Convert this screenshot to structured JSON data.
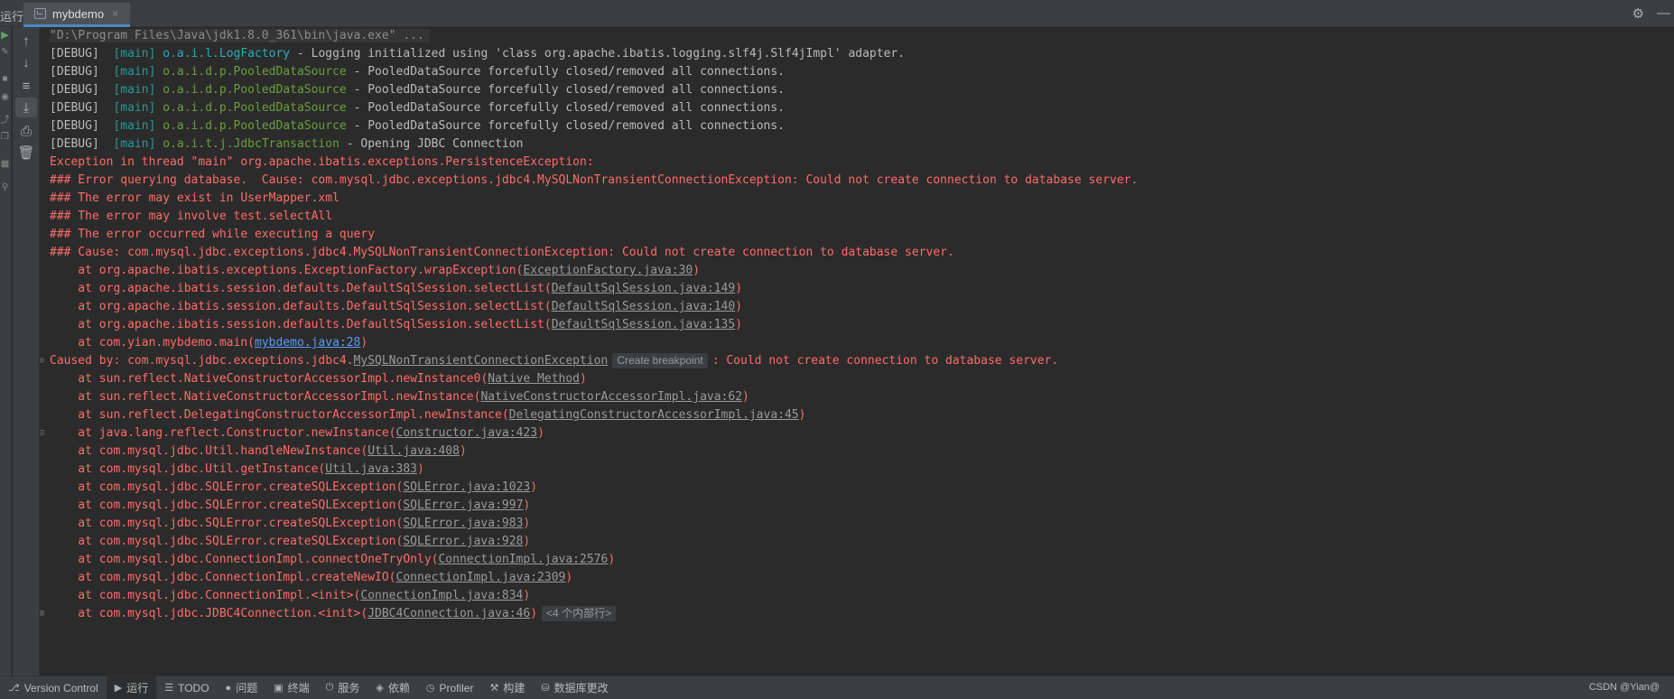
{
  "topbar": {
    "run_label": "运行:",
    "tab_title": "mybdemo",
    "tab_close": "×",
    "settings_glyph": "⚙",
    "minimize_glyph": "—"
  },
  "console": {
    "command": "\"D:\\Program Files\\Java\\jdk1.8.0_361\\bin\\java.exe\" ...",
    "debug_lines": [
      {
        "level": "[DEBUG]",
        "thread": "[main]",
        "logger": "o.a.i.l.LogFactory",
        "message": " - Logging initialized using 'class org.apache.ibatis.logging.slf4j.Slf4jImpl' adapter."
      },
      {
        "level": "[DEBUG]",
        "thread": "[main]",
        "logger": "o.a.i.d.p.PooledDataSource",
        "message": " - PooledDataSource forcefully closed/removed all connections."
      },
      {
        "level": "[DEBUG]",
        "thread": "[main]",
        "logger": "o.a.i.d.p.PooledDataSource",
        "message": " - PooledDataSource forcefully closed/removed all connections."
      },
      {
        "level": "[DEBUG]",
        "thread": "[main]",
        "logger": "o.a.i.d.p.PooledDataSource",
        "message": " - PooledDataSource forcefully closed/removed all connections."
      },
      {
        "level": "[DEBUG]",
        "thread": "[main]",
        "logger": "o.a.i.d.p.PooledDataSource",
        "message": " - PooledDataSource forcefully closed/removed all connections."
      },
      {
        "level": "[DEBUG]",
        "thread": "[main]",
        "logger": "o.a.i.t.j.JdbcTransaction",
        "message": " - Opening JDBC Connection"
      }
    ],
    "error_lines": [
      "Exception in thread \"main\" org.apache.ibatis.exceptions.PersistenceException: ",
      "### Error querying database.  Cause: com.mysql.jdbc.exceptions.jdbc4.MySQLNonTransientConnectionException: Could not create connection to database server.",
      "### The error may exist in UserMapper.xml",
      "### The error may involve test.selectAll",
      "### The error occurred while executing a query",
      "### Cause: com.mysql.jdbc.exceptions.jdbc4.MySQLNonTransientConnectionException: Could not create connection to database server."
    ],
    "stack1": [
      {
        "prefix": "    at org.apache.ibatis.exceptions.ExceptionFactory.wrapException(",
        "link": "ExceptionFactory.java:30",
        "suffix": ")"
      },
      {
        "prefix": "    at org.apache.ibatis.session.defaults.DefaultSqlSession.selectList(",
        "link": "DefaultSqlSession.java:149",
        "suffix": ")"
      },
      {
        "prefix": "    at org.apache.ibatis.session.defaults.DefaultSqlSession.selectList(",
        "link": "DefaultSqlSession.java:140",
        "suffix": ")"
      },
      {
        "prefix": "    at org.apache.ibatis.session.defaults.DefaultSqlSession.selectList(",
        "link": "DefaultSqlSession.java:135",
        "suffix": ")"
      },
      {
        "prefix": "    at com.yian.mybdemo.main(",
        "link": "mybdemo.java:28",
        "suffix": ")"
      }
    ],
    "caused_by": {
      "prefix": "Caused by: com.mysql.jdbc.exceptions.jdbc4.",
      "link": "MySQLNonTransientConnectionException",
      "chip": "Create breakpoint",
      "suffix": ": Could not create connection to database server."
    },
    "stack2": [
      {
        "prefix": "    at sun.reflect.NativeConstructorAccessorImpl.newInstance0(",
        "link": "Native Method",
        "suffix": ")"
      },
      {
        "prefix": "    at sun.reflect.NativeConstructorAccessorImpl.newInstance(",
        "link": "NativeConstructorAccessorImpl.java:62",
        "suffix": ")"
      },
      {
        "prefix": "    at sun.reflect.DelegatingConstructorAccessorImpl.newInstance(",
        "link": "DelegatingConstructorAccessorImpl.java:45",
        "suffix": ")"
      },
      {
        "prefix": "    at java.lang.reflect.Constructor.newInstance(",
        "link": "Constructor.java:423",
        "suffix": ")"
      },
      {
        "prefix": "    at com.mysql.jdbc.Util.handleNewInstance(",
        "link": "Util.java:408",
        "suffix": ")"
      },
      {
        "prefix": "    at com.mysql.jdbc.Util.getInstance(",
        "link": "Util.java:383",
        "suffix": ")"
      },
      {
        "prefix": "    at com.mysql.jdbc.SQLError.createSQLException(",
        "link": "SQLError.java:1023",
        "suffix": ")"
      },
      {
        "prefix": "    at com.mysql.jdbc.SQLError.createSQLException(",
        "link": "SQLError.java:997",
        "suffix": ")"
      },
      {
        "prefix": "    at com.mysql.jdbc.SQLError.createSQLException(",
        "link": "SQLError.java:983",
        "suffix": ")"
      },
      {
        "prefix": "    at com.mysql.jdbc.SQLError.createSQLException(",
        "link": "SQLError.java:928",
        "suffix": ")"
      },
      {
        "prefix": "    at com.mysql.jdbc.ConnectionImpl.connectOneTryOnly(",
        "link": "ConnectionImpl.java:2576",
        "suffix": ")"
      },
      {
        "prefix": "    at com.mysql.jdbc.ConnectionImpl.createNewIO(",
        "link": "ConnectionImpl.java:2309",
        "suffix": ")"
      },
      {
        "prefix": "    at com.mysql.jdbc.ConnectionImpl.<init>(",
        "link": "ConnectionImpl.java:834",
        "suffix": ")"
      },
      {
        "prefix": "    at com.mysql.jdbc.JDBC4Connection.<init>(",
        "link": "JDBC4Connection.java:46",
        "suffix": ")",
        "chip": "<4 个内部行>"
      }
    ]
  },
  "bottombar": {
    "items": [
      {
        "icon": "⎇",
        "label": "Version Control"
      },
      {
        "icon": "▶",
        "label": "运行"
      },
      {
        "icon": "☰",
        "label": "TODO"
      },
      {
        "icon": "●",
        "label": "问题"
      },
      {
        "icon": "▣",
        "label": "终端"
      },
      {
        "icon": "⏻",
        "label": "服务"
      },
      {
        "icon": "◈",
        "label": "依赖"
      },
      {
        "icon": "◷",
        "label": "Profiler"
      },
      {
        "icon": "⚒",
        "label": "构建"
      },
      {
        "icon": "⛁",
        "label": "数据库更改"
      }
    ],
    "watermark": "CSDN @Yian@"
  },
  "colors": {
    "background": "#2b2b2b",
    "error": "#ff6b68",
    "thread": "#299999",
    "logger_green": "#6a9f3c",
    "logger_teal": "#2aacb8",
    "link_blue": "#589df6",
    "tab_underline": "#4a88c7"
  }
}
